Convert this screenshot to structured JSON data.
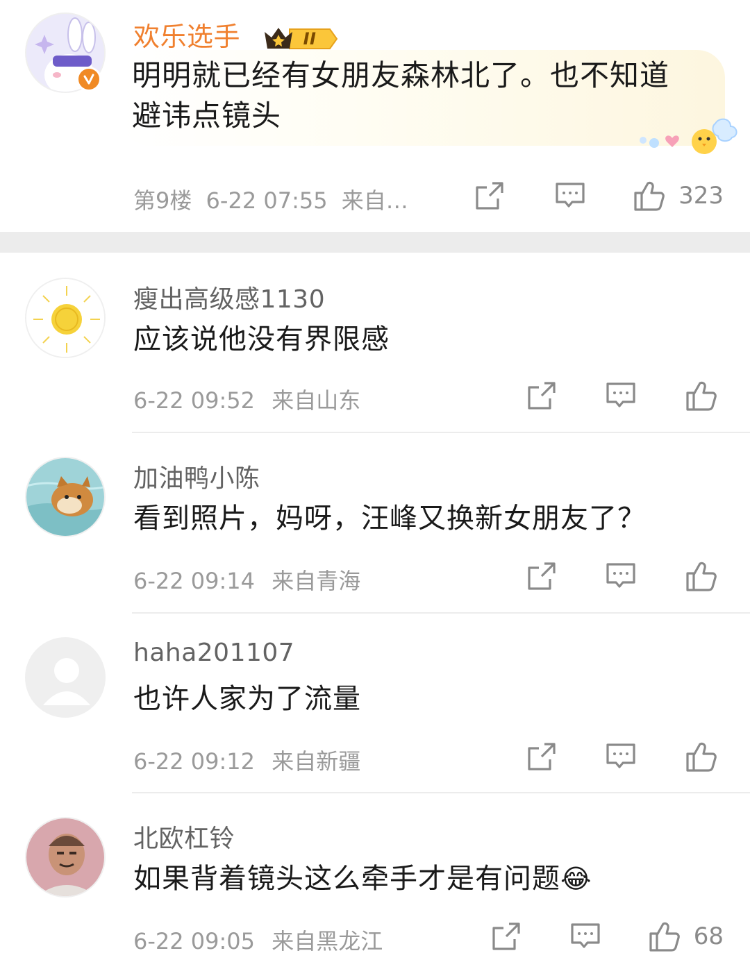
{
  "comments": [
    {
      "username": "欢乐选手",
      "badge_level": "II",
      "text_line1": "明明就已经有女朋友森林北了。也不知道",
      "text_line2": "避讳点镜头",
      "floor": "第9楼",
      "time": "6-22 07:55",
      "location": "来自…",
      "likes": "323",
      "avatar_icon": "cartoon-rabbit-avatar",
      "verified_icon": "verified-badge-icon",
      "username_color": "#f0802f"
    },
    {
      "username": "瘦出高级感1130",
      "text": "应该说他没有界限感",
      "time": "6-22 09:52",
      "location": "来自山东",
      "avatar_icon": "sun-drawing-avatar"
    },
    {
      "username": "加油鸭小陈",
      "text": "看到照片，妈呀，汪峰又换新女朋友了？",
      "time": "6-22 09:14",
      "location": "来自青海",
      "avatar_icon": "shiba-dog-avatar"
    },
    {
      "username": "haha201107",
      "text": "也许人家为了流量",
      "time": "6-22 09:12",
      "location": "来自新疆",
      "avatar_icon": "default-gray-avatar"
    },
    {
      "username": "北欧杠铃",
      "text": "如果背着镜头这么牵手才是有问题",
      "emoji": "😂",
      "time": "6-22 09:05",
      "location": "来自黑龙江",
      "likes": "68",
      "avatar_icon": "person-photo-avatar"
    }
  ],
  "icons": {
    "share": "share-icon",
    "reply": "comment-icon",
    "like": "thumbs-up-icon"
  }
}
